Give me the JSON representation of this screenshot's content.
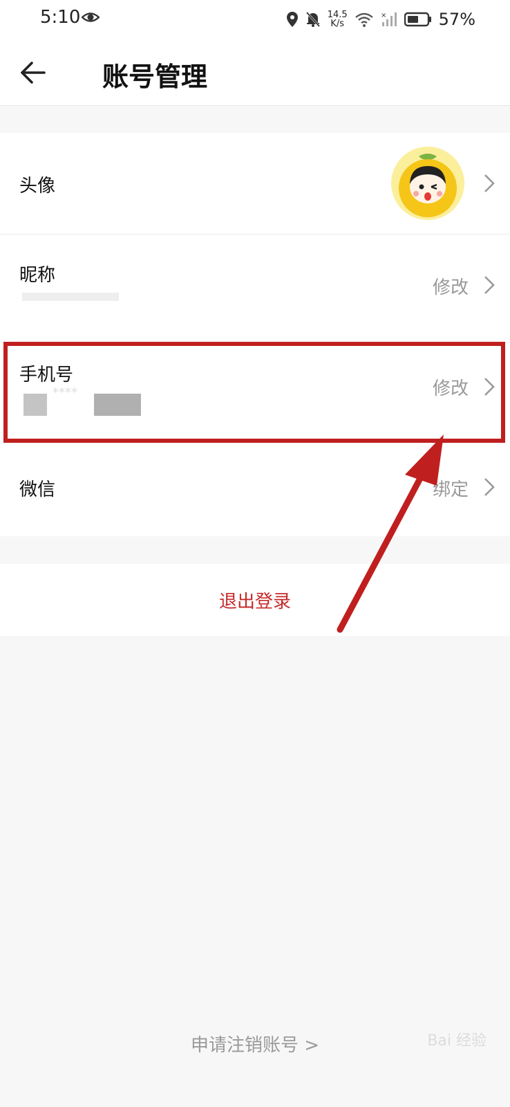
{
  "status_bar": {
    "time": "5:10",
    "net_speed_value": "14.5",
    "net_speed_unit": "K/s",
    "battery_percent": "57%",
    "icons": [
      "eye-icon",
      "location-icon",
      "mute-bell-icon",
      "wifi-icon",
      "signal-icon",
      "battery-icon"
    ]
  },
  "header": {
    "title": "账号管理",
    "back_icon": "back-arrow-icon"
  },
  "rows": {
    "avatar": {
      "label": "头像"
    },
    "nickname": {
      "label": "昵称",
      "action": "修改"
    },
    "phone": {
      "label": "手机号",
      "action": "修改",
      "value_masked": "****"
    },
    "wechat": {
      "label": "微信",
      "action": "绑定"
    }
  },
  "logout": {
    "label": "退出登录"
  },
  "cancel_account": {
    "label": "申请注销账号 >"
  },
  "watermark": {
    "text": "Bai 经验"
  },
  "colors": {
    "accent_red": "#c62828",
    "annotation_red": "#c01f1f",
    "page_bg": "#f7f7f7"
  }
}
